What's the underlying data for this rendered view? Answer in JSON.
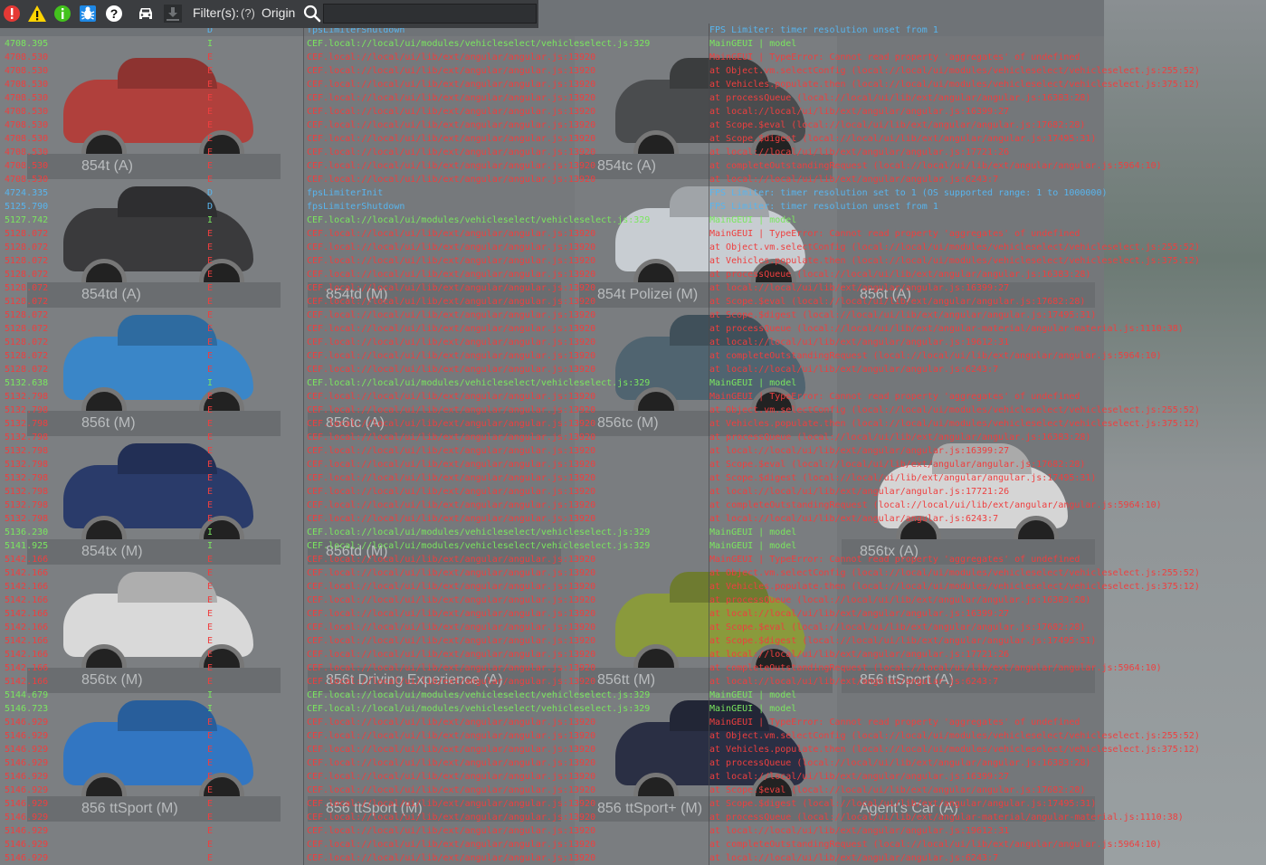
{
  "toolbar": {
    "filter_label": "Filter(s):",
    "filter_help": "(?)",
    "filter_origin": "Origin",
    "filter_value": "",
    "icons": [
      "error-filter-icon",
      "warning-filter-icon",
      "info-filter-icon",
      "debug-bug-icon",
      "help-filter-icon",
      "vehicle-icon",
      "download-icon"
    ]
  },
  "colors": {
    "info": "#7ae65f",
    "error": "#ee3f3f",
    "debug": "#58b5ee",
    "toolbar_bg": "#3b3d40"
  },
  "background": {
    "tiles": [
      {
        "label": "854t (A)"
      },
      {
        "label": "854tc (A)"
      },
      {
        "label": "854td (A)"
      },
      {
        "label": "854td (M)"
      },
      {
        "label": "854t Polizei (M)"
      },
      {
        "label": "856t (A)"
      },
      {
        "label": "856t (M)"
      },
      {
        "label": "856tc (A)"
      },
      {
        "label": "856tc (M)"
      },
      {
        "label": "854tx (M)"
      },
      {
        "label": "856td (M)"
      },
      {
        "label": "856tx (A)"
      },
      {
        "label": "856tx (M)"
      },
      {
        "label": "856t Driving Experience (A)"
      },
      {
        "label": "856tt (M)"
      },
      {
        "label": "856 ttSport (A)"
      },
      {
        "label": "856 ttSport (M)"
      },
      {
        "label": "856 ttSport (M)"
      },
      {
        "label": "856 ttSport+ (M)"
      },
      {
        "label": "Agent's Car (A)"
      }
    ]
  },
  "log": [
    {
      "t": "",
      "l": "D",
      "s": "fpsLimiterShutdown",
      "m": "FPS Limiter: timer resolution unset from 1"
    },
    {
      "t": "4708.395",
      "l": "I",
      "s": "CEF.local://local/ui/modules/vehicleselect/vehicleselect.js:329",
      "m": "MainGEUI | model"
    },
    {
      "t": "4708.530",
      "l": "E",
      "s": "CEF.local://local/ui/lib/ext/angular/angular.js:13920",
      "m": "MainGEUI | TypeError: Cannot read property 'aggregates' of undefined"
    },
    {
      "t": "4708.530",
      "l": "E",
      "s": "CEF.local://local/ui/lib/ext/angular/angular.js:13920",
      "m": "    at Object.vm.selectConfig (local://local/ui/modules/vehicleselect/vehicleselect.js:255:52)"
    },
    {
      "t": "4708.530",
      "l": "E",
      "s": "CEF.local://local/ui/lib/ext/angular/angular.js:13920",
      "m": "    at Vehicles.populate.then (local://local/ui/modules/vehicleselect/vehicleselect.js:375:12)"
    },
    {
      "t": "4708.530",
      "l": "E",
      "s": "CEF.local://local/ui/lib/ext/angular/angular.js:13920",
      "m": "    at processQueue (local://local/ui/lib/ext/angular/angular.js:16383:28)"
    },
    {
      "t": "4708.530",
      "l": "E",
      "s": "CEF.local://local/ui/lib/ext/angular/angular.js:13920",
      "m": "    at local://local/ui/lib/ext/angular/angular.js:16399:27"
    },
    {
      "t": "4708.530",
      "l": "E",
      "s": "CEF.local://local/ui/lib/ext/angular/angular.js:13920",
      "m": "    at Scope.$eval (local://local/ui/lib/ext/angular/angular.js:17682:28)"
    },
    {
      "t": "4708.530",
      "l": "E",
      "s": "CEF.local://local/ui/lib/ext/angular/angular.js:13920",
      "m": "    at Scope.$digest (local://local/ui/lib/ext/angular/angular.js:17495:31)"
    },
    {
      "t": "4708.530",
      "l": "E",
      "s": "CEF.local://local/ui/lib/ext/angular/angular.js:13920",
      "m": "    at local://local/ui/lib/ext/angular/angular.js:17721:26"
    },
    {
      "t": "4708.530",
      "l": "E",
      "s": "CEF.local://local/ui/lib/ext/angular/angular.js:13920",
      "m": "    at completeOutstandingRequest (local://local/ui/lib/ext/angular/angular.js:5964:10)"
    },
    {
      "t": "4708.530",
      "l": "E",
      "s": "CEF.local://local/ui/lib/ext/angular/angular.js:13920",
      "m": "    at local://local/ui/lib/ext/angular/angular.js:6243:7"
    },
    {
      "t": "4724.335",
      "l": "D",
      "s": "fpsLimiterInit",
      "m": "FPS Limiter: timer resolution set to 1 (OS supported range: 1 to 1000000)"
    },
    {
      "t": "5125.790",
      "l": "D",
      "s": "fpsLimiterShutdown",
      "m": "FPS Limiter: timer resolution unset from 1"
    },
    {
      "t": "5127.742",
      "l": "I",
      "s": "CEF.local://local/ui/modules/vehicleselect/vehicleselect.js:329",
      "m": "MainGEUI | model"
    },
    {
      "t": "5128.072",
      "l": "E",
      "s": "CEF.local://local/ui/lib/ext/angular/angular.js:13920",
      "m": "MainGEUI | TypeError: Cannot read property 'aggregates' of undefined"
    },
    {
      "t": "5128.072",
      "l": "E",
      "s": "CEF.local://local/ui/lib/ext/angular/angular.js:13920",
      "m": "    at Object.vm.selectConfig (local://local/ui/modules/vehicleselect/vehicleselect.js:255:52)"
    },
    {
      "t": "5128.072",
      "l": "E",
      "s": "CEF.local://local/ui/lib/ext/angular/angular.js:13920",
      "m": "    at Vehicles.populate.then (local://local/ui/modules/vehicleselect/vehicleselect.js:375:12)"
    },
    {
      "t": "5128.072",
      "l": "E",
      "s": "CEF.local://local/ui/lib/ext/angular/angular.js:13920",
      "m": "    at processQueue (local://local/ui/lib/ext/angular/angular.js:16383:28)"
    },
    {
      "t": "5128.072",
      "l": "E",
      "s": "CEF.local://local/ui/lib/ext/angular/angular.js:13920",
      "m": "    at local://local/ui/lib/ext/angular/angular.js:16399:27"
    },
    {
      "t": "5128.072",
      "l": "E",
      "s": "CEF.local://local/ui/lib/ext/angular/angular.js:13920",
      "m": "    at Scope.$eval (local://local/ui/lib/ext/angular/angular.js:17682:28)"
    },
    {
      "t": "5128.072",
      "l": "E",
      "s": "CEF.local://local/ui/lib/ext/angular/angular.js:13920",
      "m": "    at Scope.$digest (local://local/ui/lib/ext/angular/angular.js:17495:31)"
    },
    {
      "t": "5128.072",
      "l": "E",
      "s": "CEF.local://local/ui/lib/ext/angular/angular.js:13920",
      "m": "    at processQueue (local://local/ui/lib/ext/angular-material/angular-material.js:1110:38)"
    },
    {
      "t": "5128.072",
      "l": "E",
      "s": "CEF.local://local/ui/lib/ext/angular/angular.js:13920",
      "m": "    at local://local/ui/lib/ext/angular/angular.js:19612:31"
    },
    {
      "t": "5128.072",
      "l": "E",
      "s": "CEF.local://local/ui/lib/ext/angular/angular.js:13920",
      "m": "    at completeOutstandingRequest (local://local/ui/lib/ext/angular/angular.js:5964:10)"
    },
    {
      "t": "5128.072",
      "l": "E",
      "s": "CEF.local://local/ui/lib/ext/angular/angular.js:13920",
      "m": "    at local://local/ui/lib/ext/angular/angular.js:6243:7"
    },
    {
      "t": "5132.638",
      "l": "I",
      "s": "CEF.local://local/ui/modules/vehicleselect/vehicleselect.js:329",
      "m": "MainGEUI | model"
    },
    {
      "t": "5132.798",
      "l": "E",
      "s": "CEF.local://local/ui/lib/ext/angular/angular.js:13920",
      "m": "MainGEUI | TypeError: Cannot read property 'aggregates' of undefined"
    },
    {
      "t": "5132.798",
      "l": "E",
      "s": "CEF.local://local/ui/lib/ext/angular/angular.js:13920",
      "m": "    at Object.vm.selectConfig (local://local/ui/modules/vehicleselect/vehicleselect.js:255:52)"
    },
    {
      "t": "5132.798",
      "l": "E",
      "s": "CEF.local://local/ui/lib/ext/angular/angular.js:13920",
      "m": "    at Vehicles.populate.then (local://local/ui/modules/vehicleselect/vehicleselect.js:375:12)"
    },
    {
      "t": "5132.798",
      "l": "E",
      "s": "CEF.local://local/ui/lib/ext/angular/angular.js:13920",
      "m": "    at processQueue (local://local/ui/lib/ext/angular/angular.js:16383:28)"
    },
    {
      "t": "5132.798",
      "l": "E",
      "s": "CEF.local://local/ui/lib/ext/angular/angular.js:13920",
      "m": "    at local://local/ui/lib/ext/angular/angular.js:16399:27"
    },
    {
      "t": "5132.798",
      "l": "E",
      "s": "CEF.local://local/ui/lib/ext/angular/angular.js:13920",
      "m": "    at Scope.$eval (local://local/ui/lib/ext/angular/angular.js:17682:28)"
    },
    {
      "t": "5132.798",
      "l": "E",
      "s": "CEF.local://local/ui/lib/ext/angular/angular.js:13920",
      "m": "    at Scope.$digest (local://local/ui/lib/ext/angular/angular.js:17495:31)"
    },
    {
      "t": "5132.798",
      "l": "E",
      "s": "CEF.local://local/ui/lib/ext/angular/angular.js:13920",
      "m": "    at local://local/ui/lib/ext/angular/angular.js:17721:26"
    },
    {
      "t": "5132.798",
      "l": "E",
      "s": "CEF.local://local/ui/lib/ext/angular/angular.js:13920",
      "m": "    at completeOutstandingRequest (local://local/ui/lib/ext/angular/angular.js:5964:10)"
    },
    {
      "t": "5132.798",
      "l": "E",
      "s": "CEF.local://local/ui/lib/ext/angular/angular.js:13920",
      "m": "    at local://local/ui/lib/ext/angular/angular.js:6243:7"
    },
    {
      "t": "5136.230",
      "l": "I",
      "s": "CEF.local://local/ui/modules/vehicleselect/vehicleselect.js:329",
      "m": "MainGEUI | model"
    },
    {
      "t": "5141.925",
      "l": "I",
      "s": "CEF.local://local/ui/modules/vehicleselect/vehicleselect.js:329",
      "m": "MainGEUI | model"
    },
    {
      "t": "5142.166",
      "l": "E",
      "s": "CEF.local://local/ui/lib/ext/angular/angular.js:13920",
      "m": "MainGEUI | TypeError: Cannot read property 'aggregates' of undefined"
    },
    {
      "t": "5142.166",
      "l": "E",
      "s": "CEF.local://local/ui/lib/ext/angular/angular.js:13920",
      "m": "    at Object.vm.selectConfig (local://local/ui/modules/vehicleselect/vehicleselect.js:255:52)"
    },
    {
      "t": "5142.166",
      "l": "E",
      "s": "CEF.local://local/ui/lib/ext/angular/angular.js:13920",
      "m": "    at Vehicles.populate.then (local://local/ui/modules/vehicleselect/vehicleselect.js:375:12)"
    },
    {
      "t": "5142.166",
      "l": "E",
      "s": "CEF.local://local/ui/lib/ext/angular/angular.js:13920",
      "m": "    at processQueue (local://local/ui/lib/ext/angular/angular.js:16383:28)"
    },
    {
      "t": "5142.166",
      "l": "E",
      "s": "CEF.local://local/ui/lib/ext/angular/angular.js:13920",
      "m": "    at local://local/ui/lib/ext/angular/angular.js:16399:27"
    },
    {
      "t": "5142.166",
      "l": "E",
      "s": "CEF.local://local/ui/lib/ext/angular/angular.js:13920",
      "m": "    at Scope.$eval (local://local/ui/lib/ext/angular/angular.js:17682:28)"
    },
    {
      "t": "5142.166",
      "l": "E",
      "s": "CEF.local://local/ui/lib/ext/angular/angular.js:13920",
      "m": "    at Scope.$digest (local://local/ui/lib/ext/angular/angular.js:17495:31)"
    },
    {
      "t": "5142.166",
      "l": "E",
      "s": "CEF.local://local/ui/lib/ext/angular/angular.js:13920",
      "m": "    at local://local/ui/lib/ext/angular/angular.js:17721:26"
    },
    {
      "t": "5142.166",
      "l": "E",
      "s": "CEF.local://local/ui/lib/ext/angular/angular.js:13920",
      "m": "    at completeOutstandingRequest (local://local/ui/lib/ext/angular/angular.js:5964:10)"
    },
    {
      "t": "5142.166",
      "l": "E",
      "s": "CEF.local://local/ui/lib/ext/angular/angular.js:13920",
      "m": "    at local://local/ui/lib/ext/angular/angular.js:6243:7"
    },
    {
      "t": "5144.679",
      "l": "I",
      "s": "CEF.local://local/ui/modules/vehicleselect/vehicleselect.js:329",
      "m": "MainGEUI | model"
    },
    {
      "t": "5146.723",
      "l": "I",
      "s": "CEF.local://local/ui/modules/vehicleselect/vehicleselect.js:329",
      "m": "MainGEUI | model"
    },
    {
      "t": "5146.929",
      "l": "E",
      "s": "CEF.local://local/ui/lib/ext/angular/angular.js:13920",
      "m": "MainGEUI | TypeError: Cannot read property 'aggregates' of undefined"
    },
    {
      "t": "5146.929",
      "l": "E",
      "s": "CEF.local://local/ui/lib/ext/angular/angular.js:13920",
      "m": "    at Object.vm.selectConfig (local://local/ui/modules/vehicleselect/vehicleselect.js:255:52)"
    },
    {
      "t": "5146.929",
      "l": "E",
      "s": "CEF.local://local/ui/lib/ext/angular/angular.js:13920",
      "m": "    at Vehicles.populate.then (local://local/ui/modules/vehicleselect/vehicleselect.js:375:12)"
    },
    {
      "t": "5146.929",
      "l": "E",
      "s": "CEF.local://local/ui/lib/ext/angular/angular.js:13920",
      "m": "    at processQueue (local://local/ui/lib/ext/angular/angular.js:16383:28)"
    },
    {
      "t": "5146.929",
      "l": "E",
      "s": "CEF.local://local/ui/lib/ext/angular/angular.js:13920",
      "m": "    at local://local/ui/lib/ext/angular/angular.js:16399:27"
    },
    {
      "t": "5146.929",
      "l": "E",
      "s": "CEF.local://local/ui/lib/ext/angular/angular.js:13920",
      "m": "    at Scope.$eval (local://local/ui/lib/ext/angular/angular.js:17682:28)"
    },
    {
      "t": "5146.929",
      "l": "E",
      "s": "CEF.local://local/ui/lib/ext/angular/angular.js:13920",
      "m": "    at Scope.$digest (local://local/ui/lib/ext/angular/angular.js:17495:31)"
    },
    {
      "t": "5146.929",
      "l": "E",
      "s": "CEF.local://local/ui/lib/ext/angular/angular.js:13920",
      "m": "    at processQueue (local://local/ui/lib/ext/angular-material/angular-material.js:1110:38)"
    },
    {
      "t": "5146.929",
      "l": "E",
      "s": "CEF.local://local/ui/lib/ext/angular/angular.js:13920",
      "m": "    at local://local/ui/lib/ext/angular/angular.js:19612:31"
    },
    {
      "t": "5146.929",
      "l": "E",
      "s": "CEF.local://local/ui/lib/ext/angular/angular.js:13920",
      "m": "    at completeOutstandingRequest (local://local/ui/lib/ext/angular/angular.js:5964:10)"
    },
    {
      "t": "5146.929",
      "l": "E",
      "s": "CEF.local://local/ui/lib/ext/angular/angular.js:13920",
      "m": "    at local://local/ui/lib/ext/angular/angular.js:6243:7"
    }
  ]
}
